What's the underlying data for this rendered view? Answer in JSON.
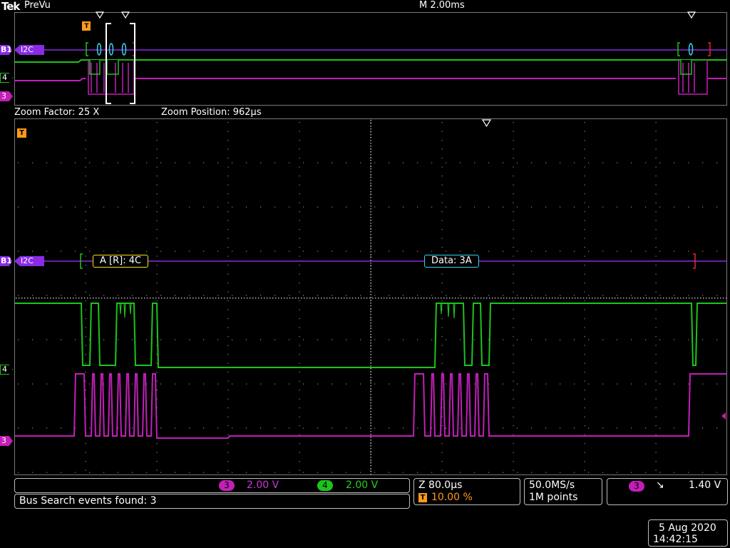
{
  "header": {
    "brand": "Tek",
    "mode": "PreVu",
    "timebase": "M 2.00ms"
  },
  "zoom": {
    "factor_text": "Zoom Factor: 25 X",
    "position_text": "Zoom Position: 962µs"
  },
  "labels": {
    "bus": "I2C",
    "bus_id": "B1",
    "ch3": "3",
    "ch4": "4",
    "trigger": "T"
  },
  "decode": {
    "address": "A [R]: 4C",
    "data": "Data: 3A"
  },
  "status": {
    "ch3_scale": "2.00 V",
    "ch4_scale": "2.00 V",
    "search": "Bus Search events found: 3",
    "zoom_time": "Z 80.0µs",
    "trigger_pos": "10.00 %",
    "sample_rate": "50.0MS/s",
    "record_length": "1M points",
    "trig_source": "3",
    "trig_slope": "↘",
    "trig_level": "1.40 V",
    "date": "5 Aug 2020",
    "time": "14:42:15"
  },
  "colors": {
    "bus": "#8b2be6",
    "ch3": "#c21fb8",
    "ch4": "#1cc41c",
    "trigger": "#ff9a1a",
    "addr": "#f5e419",
    "data": "#36d4e8"
  }
}
